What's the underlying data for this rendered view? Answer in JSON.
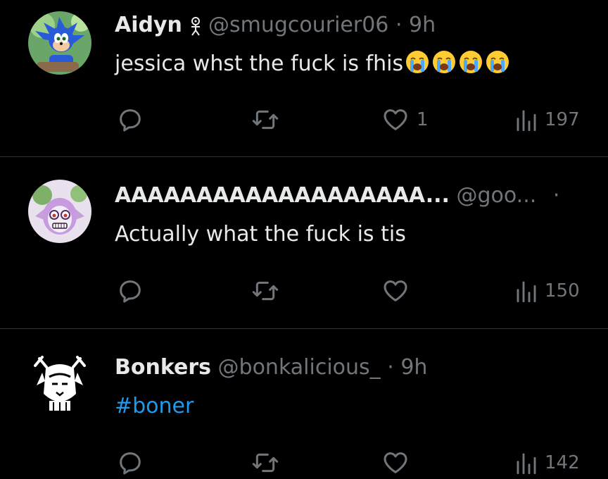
{
  "tweets": [
    {
      "name": "Aidyn",
      "handle": "@smugcourier06",
      "dot": "·",
      "time": "9h",
      "text": "jessica whst the fuck is fhis",
      "emoji_count": 4,
      "likes": "1",
      "views": "197"
    },
    {
      "name": "AAAAAAAAAAAAAAAAAAA...",
      "handle": "@goo...",
      "dot": "·",
      "time": "",
      "text": "Actually what the fuck is tis",
      "likes": "",
      "views": "150"
    },
    {
      "name": "Bonkers",
      "handle": "@bonkalicious_",
      "dot": "·",
      "time": "9h",
      "text": "#boner",
      "likes": "",
      "views": "142"
    }
  ],
  "colors": {
    "background": "#000000",
    "text": "#e7e9ea",
    "muted": "#71767b",
    "hashtag": "#1d9bf0",
    "divider": "#2f3336"
  }
}
